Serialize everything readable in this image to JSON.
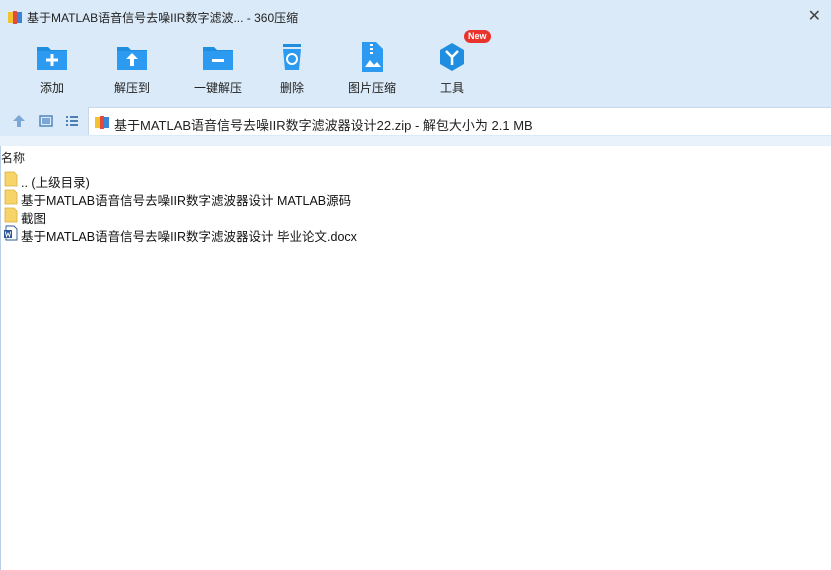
{
  "window": {
    "title": "基于MATLAB语音信号去噪IIR数字滤波... - 360压缩",
    "close_glyph": "✕"
  },
  "toolbar": {
    "items": [
      {
        "label": "添加",
        "icon": "add-folder-icon"
      },
      {
        "label": "解压到",
        "icon": "extract-to-icon"
      },
      {
        "label": "一键解压",
        "icon": "one-click-extract-icon"
      },
      {
        "label": "删除",
        "icon": "recycle-bin-icon"
      },
      {
        "label": "图片压缩",
        "icon": "image-compress-icon"
      },
      {
        "label": "工具",
        "icon": "tools-icon",
        "badge": "New"
      }
    ]
  },
  "navbar": {
    "path": "基于MATLAB语音信号去噪IIR数字滤波器设计22.zip - 解包大小为 2.1 MB"
  },
  "columns": {
    "name": "名称"
  },
  "files": [
    {
      "name": ".. (上级目录)",
      "type": "folder"
    },
    {
      "name": "基于MATLAB语音信号去噪IIR数字滤波器设计 MATLAB源码",
      "type": "folder"
    },
    {
      "name": "截图",
      "type": "folder"
    },
    {
      "name": "基于MATLAB语音信号去噪IIR数字滤波器设计 毕业论文.docx",
      "type": "word"
    }
  ],
  "colors": {
    "chrome_bg": "#dbeaf8",
    "accent_blue": "#1f8ee0",
    "folder_yellow": "#f6d46a",
    "badge_red": "#e8342c"
  }
}
